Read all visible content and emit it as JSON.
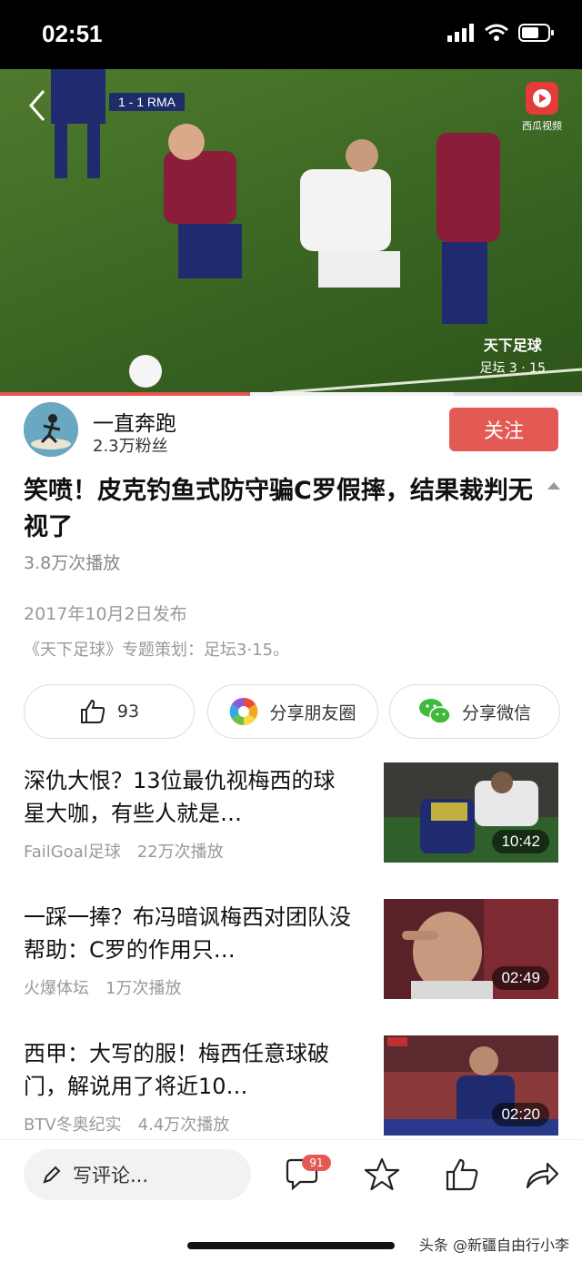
{
  "status_bar": {
    "time": "02:51"
  },
  "video": {
    "score": "1 - 1 RMA",
    "brand": "西瓜视频",
    "watermark_title": "天下足球",
    "watermark_sub": "足坛 3 · 15",
    "progress_percent": 43,
    "buffered_percent": 78
  },
  "author": {
    "name": "一直奔跑",
    "fans": "2.3万粉丝",
    "follow_label": "关注"
  },
  "article": {
    "title": "笑喷！皮克钓鱼式防守骗C罗假摔，结果裁判无视了",
    "plays": "3.8万次播放",
    "pub_date": "2017年10月2日发布",
    "description": "《天下足球》专题策划：足坛3·15。"
  },
  "actions": {
    "like_count": "93",
    "share_moments": "分享朋友圈",
    "share_wechat": "分享微信"
  },
  "feed": [
    {
      "title": "深仇大恨？13位最仇视梅西的球星大咖，有些人就是…",
      "source": "FailGoal足球",
      "plays": "22万次播放",
      "duration": "10:42"
    },
    {
      "title": "一踩一捧？布冯暗讽梅西对团队没帮助：C罗的作用只…",
      "source": "火爆体坛",
      "plays": "1万次播放",
      "duration": "02:49"
    },
    {
      "title": "西甲：大写的服！梅西任意球破门，解说用了将近10…",
      "source": "BTV冬奥纪实",
      "plays": "4.4万次播放",
      "duration": "02:20"
    }
  ],
  "bottom_bar": {
    "comment_placeholder": "写评论...",
    "comment_count": "91"
  },
  "watermark": "头条 @新疆自由行小李",
  "colors": {
    "accent": "#e35a55"
  }
}
